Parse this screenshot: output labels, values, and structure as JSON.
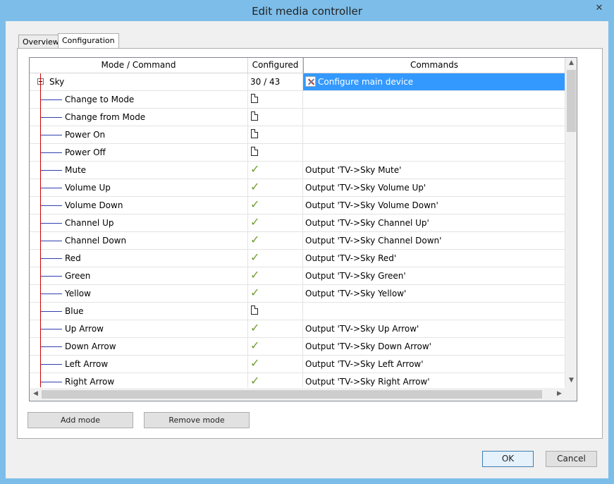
{
  "window": {
    "title": "Edit media controller",
    "close_glyph": "✕"
  },
  "tabs": [
    {
      "label": "Overview"
    },
    {
      "label": "Configuration"
    }
  ],
  "grid": {
    "headers": {
      "mode": "Mode / Command",
      "configured": "Configured",
      "commands": "Commands"
    },
    "root": {
      "label": "Sky",
      "configured": "30 / 43",
      "command": "Configure main device",
      "icon": "tools-icon"
    },
    "rows": [
      {
        "label": "Change to Mode",
        "status": "doc",
        "command": ""
      },
      {
        "label": "Change from Mode",
        "status": "doc",
        "command": ""
      },
      {
        "label": "Power On",
        "status": "doc",
        "command": ""
      },
      {
        "label": "Power Off",
        "status": "doc",
        "command": ""
      },
      {
        "label": "Mute",
        "status": "check",
        "command": "Output 'TV->Sky Mute'"
      },
      {
        "label": "Volume Up",
        "status": "check",
        "command": "Output 'TV->Sky Volume Up'"
      },
      {
        "label": "Volume Down",
        "status": "check",
        "command": "Output 'TV->Sky Volume Down'"
      },
      {
        "label": "Channel Up",
        "status": "check",
        "command": "Output 'TV->Sky Channel Up'"
      },
      {
        "label": "Channel Down",
        "status": "check",
        "command": "Output 'TV->Sky Channel Down'"
      },
      {
        "label": "Red",
        "status": "check",
        "command": "Output 'TV->Sky Red'"
      },
      {
        "label": "Green",
        "status": "check",
        "command": "Output 'TV->Sky Green'"
      },
      {
        "label": "Yellow",
        "status": "check",
        "command": "Output 'TV->Sky Yellow'"
      },
      {
        "label": "Blue",
        "status": "doc",
        "command": ""
      },
      {
        "label": "Up Arrow",
        "status": "check",
        "command": "Output 'TV->Sky Up Arrow'"
      },
      {
        "label": "Down Arrow",
        "status": "check",
        "command": "Output 'TV->Sky Down Arrow'"
      },
      {
        "label": "Left Arrow",
        "status": "check",
        "command": "Output 'TV->Sky Left Arrow'"
      },
      {
        "label": "Right Arrow",
        "status": "check",
        "command": "Output 'TV->Sky Right Arrow'"
      }
    ]
  },
  "buttons": {
    "add_mode": "Add mode",
    "remove_mode": "Remove mode",
    "ok": "OK",
    "cancel": "Cancel"
  },
  "colors": {
    "selection": "#3399ff",
    "check": "#6f9c2e",
    "window_frame": "#7dbde9"
  }
}
